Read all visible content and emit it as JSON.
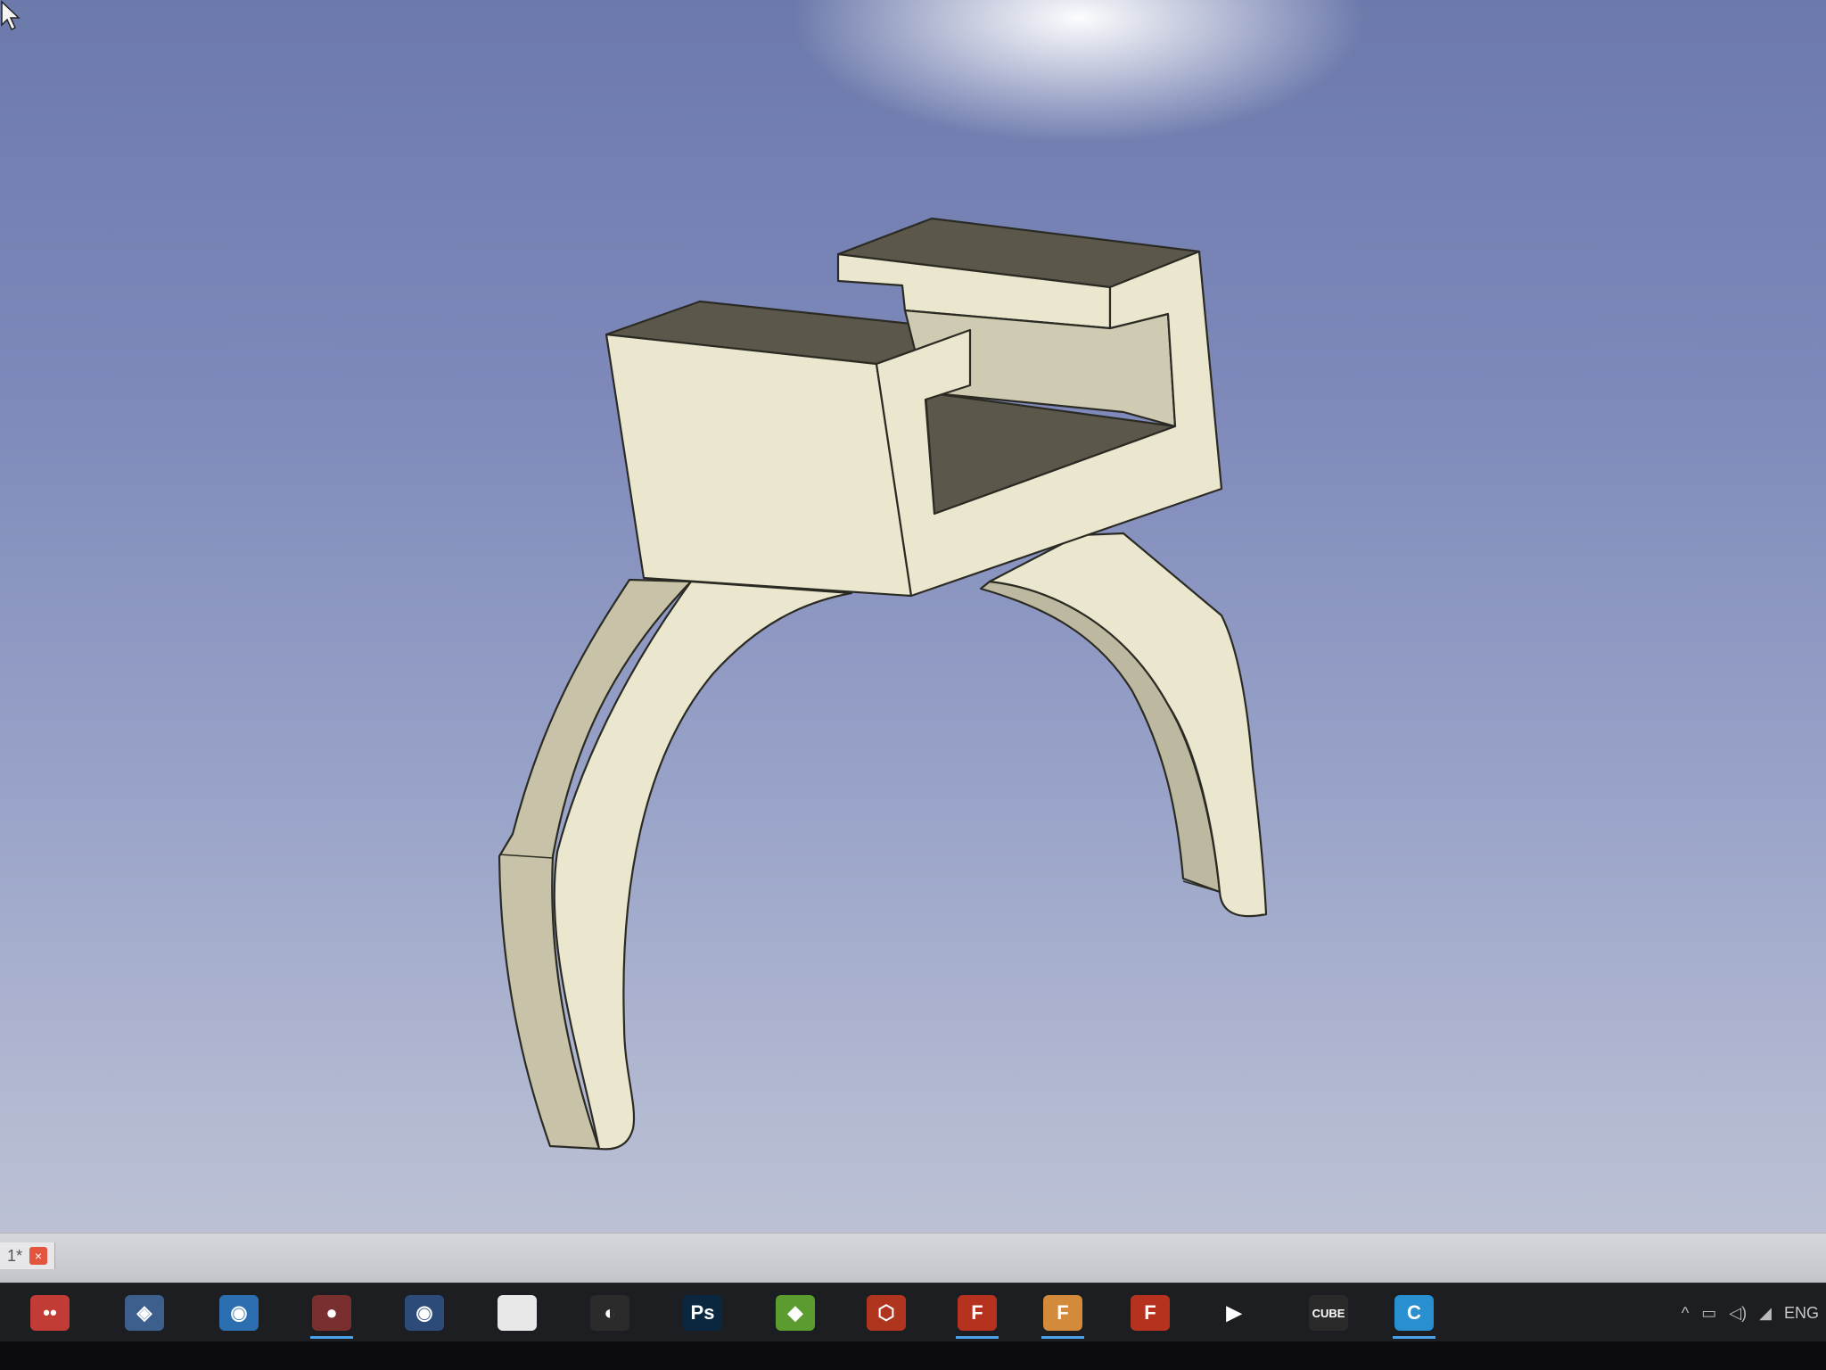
{
  "document_tab": {
    "label": "1*",
    "close_label": "×"
  },
  "taskbar": {
    "apps": [
      {
        "name": "red-face-app",
        "label": "••",
        "color": "#c23b35",
        "active": false
      },
      {
        "name": "cube-app",
        "label": "◈",
        "color": "#3d5f8e",
        "active": false
      },
      {
        "name": "webcam-app",
        "label": "◉",
        "color": "#2b6fb0",
        "active": false
      },
      {
        "name": "camera-app",
        "label": "●",
        "color": "#7a2f2f",
        "active": true
      },
      {
        "name": "disc-app",
        "label": "◉",
        "color": "#2d4b78",
        "active": false
      },
      {
        "name": "file-app",
        "label": "",
        "color": "#e8e8e8",
        "active": false
      },
      {
        "name": "obs-app",
        "label": "◐",
        "color": "#2b2b2b",
        "active": false
      },
      {
        "name": "photoshop-app",
        "label": "Ps",
        "color": "#0b2740",
        "active": false
      },
      {
        "name": "bluestacks-app",
        "label": "◆",
        "color": "#5b9b2f",
        "active": false
      },
      {
        "name": "red-box-app",
        "label": "⬡",
        "color": "#b0351f",
        "active": false
      },
      {
        "name": "freecad-app-1",
        "label": "F",
        "color": "#b5321f",
        "active": true
      },
      {
        "name": "fusion-app",
        "label": "F",
        "color": "#d38a3b",
        "active": true
      },
      {
        "name": "freecad-app-2",
        "label": "F",
        "color": "#b5321f",
        "active": false
      },
      {
        "name": "media-player-app",
        "label": "▶",
        "color": "#1d1e22",
        "active": false
      },
      {
        "name": "cube-logo-app",
        "label": "CUBE",
        "color": "#2a2a2a",
        "active": false
      },
      {
        "name": "cura-app",
        "label": "C",
        "color": "#2a8fd1",
        "active": true
      }
    ],
    "tray": {
      "chevron": "^",
      "battery": "▭",
      "volume": "◁)",
      "network": "◢",
      "language": "ENG"
    }
  }
}
